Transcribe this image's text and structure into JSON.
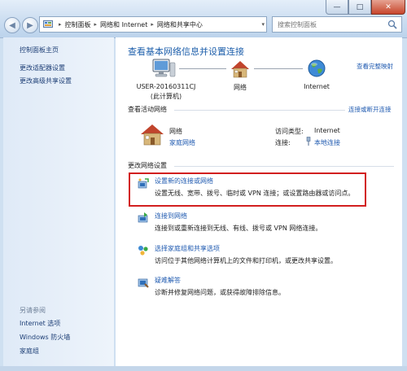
{
  "window": {
    "controls": {
      "minimize": "—",
      "maximize": "□",
      "close": "✕"
    }
  },
  "navigation": {
    "back": "◀",
    "forward": "▶",
    "dropdown": "▾",
    "refresh": "⟳"
  },
  "address_bar": {
    "crumbs": [
      "控制面板",
      "网络和 Internet",
      "网络和共享中心"
    ],
    "separator": "▸",
    "dropdown": "▾"
  },
  "search": {
    "placeholder": "搜索控制面板"
  },
  "sidebar": {
    "items": [
      "控制面板主页",
      "更改适配器设置",
      "更改高级共享设置"
    ],
    "see_also_title": "另请参阅",
    "see_also": [
      "Internet 选项",
      "Windows 防火墙",
      "家庭组"
    ]
  },
  "main": {
    "title": "查看基本网络信息并设置连接",
    "full_map_link": "查看完整映射",
    "map": {
      "computer_name": "USER-20160311CJ",
      "computer_sub": "(此计算机)",
      "network": "网络",
      "internet": "Internet"
    },
    "active_networks_title": "查看活动网络",
    "connect_disconnect_link": "连接或断开连接",
    "active_network": {
      "name": "网络",
      "type_link": "家庭网络",
      "access_type_label": "访问类型:",
      "access_type_value": "Internet",
      "connection_label": "连接:",
      "connection_value": "本地连接"
    },
    "change_settings_title": "更改网络设置",
    "tasks": [
      {
        "title": "设置新的连接或网络",
        "desc": "设置无线、宽带、拨号、临时或 VPN 连接；或设置路由器或访问点。"
      },
      {
        "title": "连接到网络",
        "desc": "连接到或重新连接到无线、有线、拨号或 VPN 网络连接。"
      },
      {
        "title": "选择家庭组和共享选项",
        "desc": "访问位于其他网络计算机上的文件和打印机，或更改共享设置。"
      },
      {
        "title": "疑难解答",
        "desc": "诊断并修复网络问题，或获得故障排除信息。"
      }
    ]
  },
  "colors": {
    "link": "#1f5ab0",
    "title": "#1e5fab",
    "highlight_border": "#d21f1f"
  }
}
